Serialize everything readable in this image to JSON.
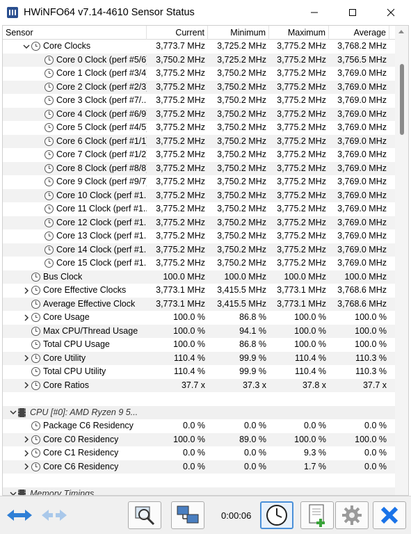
{
  "window": {
    "title": "HWiNFO64 v7.14-4610 Sensor Status",
    "minimize_label": "Minimize",
    "maximize_label": "Maximize",
    "close_label": "Close"
  },
  "columns": [
    "Sensor",
    "Current",
    "Minimum",
    "Maximum",
    "Average"
  ],
  "rows": [
    {
      "type": "sensor",
      "indent": 1,
      "expander": "expanded",
      "icon": "clock",
      "label": "Core Clocks",
      "current": "3,773.7 MHz",
      "minimum": "3,725.2 MHz",
      "maximum": "3,775.2 MHz",
      "average": "3,768.2 MHz"
    },
    {
      "type": "sensor",
      "indent": 2,
      "expander": "none",
      "icon": "clock",
      "label": "Core 0 Clock (perf #5/6)",
      "current": "3,750.2 MHz",
      "minimum": "3,725.2 MHz",
      "maximum": "3,775.2 MHz",
      "average": "3,756.5 MHz"
    },
    {
      "type": "sensor",
      "indent": 2,
      "expander": "none",
      "icon": "clock",
      "label": "Core 1 Clock (perf #3/4)",
      "current": "3,775.2 MHz",
      "minimum": "3,750.2 MHz",
      "maximum": "3,775.2 MHz",
      "average": "3,769.0 MHz"
    },
    {
      "type": "sensor",
      "indent": 2,
      "expander": "none",
      "icon": "clock",
      "label": "Core 2 Clock (perf #2/3)",
      "current": "3,775.2 MHz",
      "minimum": "3,750.2 MHz",
      "maximum": "3,775.2 MHz",
      "average": "3,769.0 MHz"
    },
    {
      "type": "sensor",
      "indent": 2,
      "expander": "none",
      "icon": "clock",
      "label": "Core 3 Clock (perf #7/...",
      "current": "3,775.2 MHz",
      "minimum": "3,750.2 MHz",
      "maximum": "3,775.2 MHz",
      "average": "3,769.0 MHz"
    },
    {
      "type": "sensor",
      "indent": 2,
      "expander": "none",
      "icon": "clock",
      "label": "Core 4 Clock (perf #6/9)",
      "current": "3,775.2 MHz",
      "minimum": "3,750.2 MHz",
      "maximum": "3,775.2 MHz",
      "average": "3,769.0 MHz"
    },
    {
      "type": "sensor",
      "indent": 2,
      "expander": "none",
      "icon": "clock",
      "label": "Core 5 Clock (perf #4/5)",
      "current": "3,775.2 MHz",
      "minimum": "3,750.2 MHz",
      "maximum": "3,775.2 MHz",
      "average": "3,769.0 MHz"
    },
    {
      "type": "sensor",
      "indent": 2,
      "expander": "none",
      "icon": "clock",
      "label": "Core 6 Clock (perf #1/1)",
      "current": "3,775.2 MHz",
      "minimum": "3,750.2 MHz",
      "maximum": "3,775.2 MHz",
      "average": "3,769.0 MHz"
    },
    {
      "type": "sensor",
      "indent": 2,
      "expander": "none",
      "icon": "clock",
      "label": "Core 7 Clock (perf #1/2)",
      "current": "3,775.2 MHz",
      "minimum": "3,750.2 MHz",
      "maximum": "3,775.2 MHz",
      "average": "3,769.0 MHz"
    },
    {
      "type": "sensor",
      "indent": 2,
      "expander": "none",
      "icon": "clock",
      "label": "Core 8 Clock (perf #8/8)",
      "current": "3,775.2 MHz",
      "minimum": "3,750.2 MHz",
      "maximum": "3,775.2 MHz",
      "average": "3,769.0 MHz"
    },
    {
      "type": "sensor",
      "indent": 2,
      "expander": "none",
      "icon": "clock",
      "label": "Core 9 Clock (perf #9/7)",
      "current": "3,775.2 MHz",
      "minimum": "3,750.2 MHz",
      "maximum": "3,775.2 MHz",
      "average": "3,769.0 MHz"
    },
    {
      "type": "sensor",
      "indent": 2,
      "expander": "none",
      "icon": "clock",
      "label": "Core 10 Clock (perf #1...",
      "current": "3,775.2 MHz",
      "minimum": "3,750.2 MHz",
      "maximum": "3,775.2 MHz",
      "average": "3,769.0 MHz"
    },
    {
      "type": "sensor",
      "indent": 2,
      "expander": "none",
      "icon": "clock",
      "label": "Core 11 Clock (perf #1...",
      "current": "3,775.2 MHz",
      "minimum": "3,750.2 MHz",
      "maximum": "3,775.2 MHz",
      "average": "3,769.0 MHz"
    },
    {
      "type": "sensor",
      "indent": 2,
      "expander": "none",
      "icon": "clock",
      "label": "Core 12 Clock (perf #1...",
      "current": "3,775.2 MHz",
      "minimum": "3,750.2 MHz",
      "maximum": "3,775.2 MHz",
      "average": "3,769.0 MHz"
    },
    {
      "type": "sensor",
      "indent": 2,
      "expander": "none",
      "icon": "clock",
      "label": "Core 13 Clock (perf #1...",
      "current": "3,775.2 MHz",
      "minimum": "3,750.2 MHz",
      "maximum": "3,775.2 MHz",
      "average": "3,769.0 MHz"
    },
    {
      "type": "sensor",
      "indent": 2,
      "expander": "none",
      "icon": "clock",
      "label": "Core 14 Clock (perf #1...",
      "current": "3,775.2 MHz",
      "minimum": "3,750.2 MHz",
      "maximum": "3,775.2 MHz",
      "average": "3,769.0 MHz"
    },
    {
      "type": "sensor",
      "indent": 2,
      "expander": "none",
      "icon": "clock",
      "label": "Core 15 Clock (perf #1...",
      "current": "3,775.2 MHz",
      "minimum": "3,750.2 MHz",
      "maximum": "3,775.2 MHz",
      "average": "3,769.0 MHz"
    },
    {
      "type": "sensor",
      "indent": 1,
      "expander": "none",
      "icon": "clock",
      "label": "Bus Clock",
      "current": "100.0 MHz",
      "minimum": "100.0 MHz",
      "maximum": "100.0 MHz",
      "average": "100.0 MHz"
    },
    {
      "type": "sensor",
      "indent": 1,
      "expander": "collapsed",
      "icon": "clock",
      "label": "Core Effective Clocks",
      "current": "3,773.1 MHz",
      "minimum": "3,415.5 MHz",
      "maximum": "3,773.1 MHz",
      "average": "3,768.6 MHz"
    },
    {
      "type": "sensor",
      "indent": 1,
      "expander": "none",
      "icon": "clock",
      "label": "Average Effective Clock",
      "current": "3,773.1 MHz",
      "minimum": "3,415.5 MHz",
      "maximum": "3,773.1 MHz",
      "average": "3,768.6 MHz"
    },
    {
      "type": "sensor",
      "indent": 1,
      "expander": "collapsed",
      "icon": "clock",
      "label": "Core Usage",
      "current": "100.0 %",
      "minimum": "86.8 %",
      "maximum": "100.0 %",
      "average": "100.0 %"
    },
    {
      "type": "sensor",
      "indent": 1,
      "expander": "none",
      "icon": "clock",
      "label": "Max CPU/Thread Usage",
      "current": "100.0 %",
      "minimum": "94.1 %",
      "maximum": "100.0 %",
      "average": "100.0 %"
    },
    {
      "type": "sensor",
      "indent": 1,
      "expander": "none",
      "icon": "clock",
      "label": "Total CPU Usage",
      "current": "100.0 %",
      "minimum": "86.8 %",
      "maximum": "100.0 %",
      "average": "100.0 %"
    },
    {
      "type": "sensor",
      "indent": 1,
      "expander": "collapsed",
      "icon": "clock",
      "label": "Core Utility",
      "current": "110.4 %",
      "minimum": "99.9 %",
      "maximum": "110.4 %",
      "average": "110.3 %"
    },
    {
      "type": "sensor",
      "indent": 1,
      "expander": "none",
      "icon": "clock",
      "label": "Total CPU Utility",
      "current": "110.4 %",
      "minimum": "99.9 %",
      "maximum": "110.4 %",
      "average": "110.3 %"
    },
    {
      "type": "sensor",
      "indent": 1,
      "expander": "collapsed",
      "icon": "clock",
      "label": "Core Ratios",
      "current": "37.7 x",
      "minimum": "37.3 x",
      "maximum": "37.8 x",
      "average": "37.7 x"
    },
    {
      "type": "empty"
    },
    {
      "type": "group",
      "indent": 0,
      "expander": "expanded",
      "icon": "chip",
      "label": "CPU [#0]: AMD Ryzen 9 5..."
    },
    {
      "type": "sensor",
      "indent": 1,
      "expander": "none",
      "icon": "clock",
      "label": "Package C6 Residency",
      "current": "0.0 %",
      "minimum": "0.0 %",
      "maximum": "0.0 %",
      "average": "0.0 %"
    },
    {
      "type": "sensor",
      "indent": 1,
      "expander": "collapsed",
      "icon": "clock",
      "label": "Core C0 Residency",
      "current": "100.0 %",
      "minimum": "89.0 %",
      "maximum": "100.0 %",
      "average": "100.0 %"
    },
    {
      "type": "sensor",
      "indent": 1,
      "expander": "collapsed",
      "icon": "clock",
      "label": "Core C1 Residency",
      "current": "0.0 %",
      "minimum": "0.0 %",
      "maximum": "9.3 %",
      "average": "0.0 %"
    },
    {
      "type": "sensor",
      "indent": 1,
      "expander": "collapsed",
      "icon": "clock",
      "label": "Core C6 Residency",
      "current": "0.0 %",
      "minimum": "0.0 %",
      "maximum": "1.7 %",
      "average": "0.0 %"
    },
    {
      "type": "empty"
    },
    {
      "type": "group",
      "indent": 0,
      "expander": "expanded",
      "icon": "chip",
      "label": "Memory Timings"
    }
  ],
  "toolbar": {
    "elapsed_time": "0:00:06",
    "buttons": [
      {
        "name": "navigate-forward-back-button",
        "icon": "double-arrow-icon"
      },
      {
        "name": "navigate-disabled-button",
        "icon": "double-arrow-disabled-icon"
      },
      {
        "name": "sensor-search-button",
        "icon": "magnifier-monitor-icon"
      },
      {
        "name": "network-button",
        "icon": "network-computers-icon"
      },
      {
        "name": "reset-timer-button",
        "icon": "clock-icon"
      },
      {
        "name": "logging-button",
        "icon": "document-add-icon"
      },
      {
        "name": "settings-button",
        "icon": "gear-icon"
      },
      {
        "name": "close-sensors-button",
        "icon": "close-x-icon"
      }
    ]
  },
  "colors": {
    "accent": "#1e88e5",
    "arrow_blue": "#2f7fd6",
    "close_blue": "#1a73e8",
    "icon_grey": "#555555"
  }
}
